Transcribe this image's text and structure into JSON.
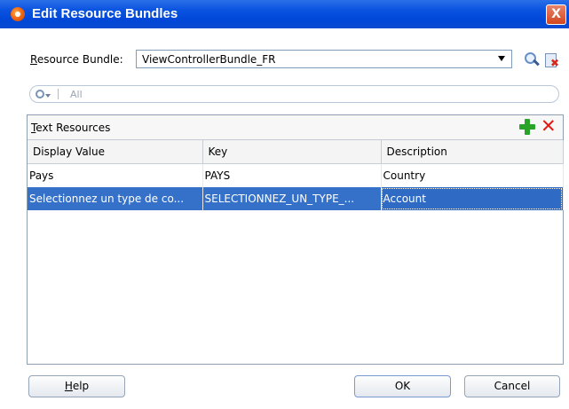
{
  "window": {
    "title": "Edit Resource Bundles",
    "close_label": "X"
  },
  "resource_bundle": {
    "label_mnemonic": "R",
    "label_rest": "esource Bundle:",
    "selected": "ViewControllerBundle_FR"
  },
  "filter": {
    "placeholder": "All"
  },
  "panel": {
    "label_mnemonic": "T",
    "label_rest": "ext Resources",
    "columns": [
      "Display Value",
      "Key",
      "Description"
    ],
    "rows": [
      {
        "display_value": "Pays",
        "key": "PAYS",
        "description": "Country"
      },
      {
        "display_value": "Selectionnez un type de co...",
        "key": "SELECTIONNEZ_UN_TYPE_...",
        "description": "Account"
      }
    ]
  },
  "buttons": {
    "help_mnemonic": "H",
    "help_rest": "elp",
    "ok": "OK",
    "cancel": "Cancel"
  }
}
